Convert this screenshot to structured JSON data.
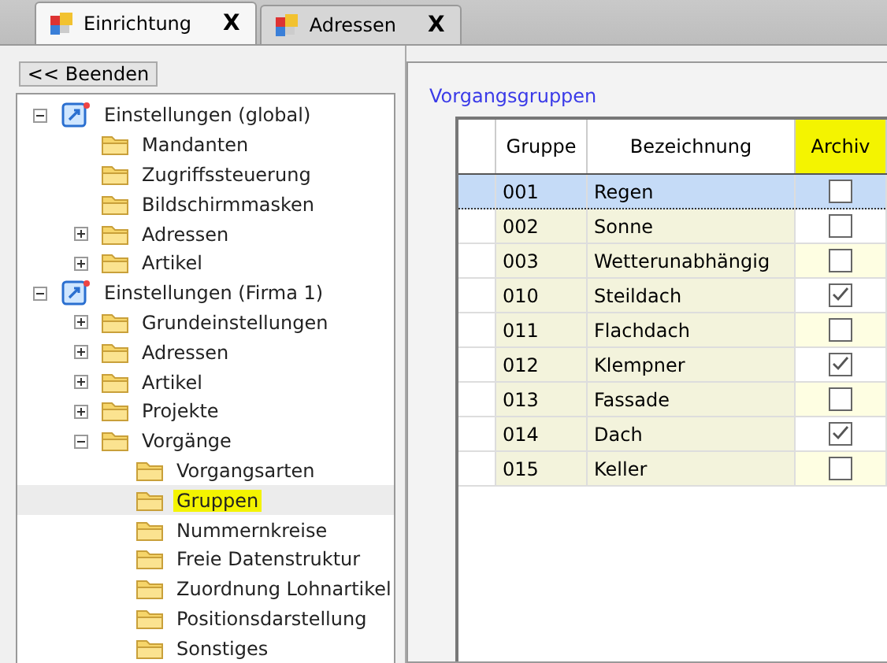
{
  "tabs": [
    {
      "label": "Einrichtung",
      "close": "X",
      "selected": true
    },
    {
      "label": "Adressen",
      "close": "X",
      "selected": false
    }
  ],
  "back_button": "<< Beenden",
  "tree": [
    {
      "label": "Einstellungen (global)",
      "kind": "settings",
      "expanded": true,
      "selected": false,
      "highlighted": false,
      "children": [
        {
          "label": "Mandanten",
          "kind": "folder",
          "selected": false,
          "highlighted": false
        },
        {
          "label": "Zugriffssteuerung",
          "kind": "folder",
          "selected": false,
          "highlighted": false
        },
        {
          "label": "Bildschirmmasken",
          "kind": "folder",
          "selected": false,
          "highlighted": false
        },
        {
          "label": "Adressen",
          "kind": "folder",
          "expanded": false,
          "selected": false,
          "highlighted": false
        },
        {
          "label": "Artikel",
          "kind": "folder",
          "expanded": false,
          "selected": false,
          "highlighted": false
        }
      ]
    },
    {
      "label": "Einstellungen (Firma 1)",
      "kind": "settings",
      "expanded": true,
      "selected": false,
      "highlighted": false,
      "children": [
        {
          "label": "Grundeinstellungen",
          "kind": "folder",
          "expanded": false,
          "selected": false,
          "highlighted": false
        },
        {
          "label": "Adressen",
          "kind": "folder",
          "expanded": false,
          "selected": false,
          "highlighted": false
        },
        {
          "label": "Artikel",
          "kind": "folder",
          "expanded": false,
          "selected": false,
          "highlighted": false
        },
        {
          "label": "Projekte",
          "kind": "folder",
          "expanded": false,
          "selected": false,
          "highlighted": false
        },
        {
          "label": "Vorgänge",
          "kind": "folder",
          "expanded": true,
          "selected": false,
          "highlighted": false,
          "children": [
            {
              "label": "Vorgangsarten",
              "kind": "folder",
              "selected": false,
              "highlighted": false
            },
            {
              "label": "Gruppen",
              "kind": "folder",
              "selected": true,
              "highlighted": true
            },
            {
              "label": "Nummernkreise",
              "kind": "folder",
              "selected": false,
              "highlighted": false
            },
            {
              "label": "Freie Datenstruktur",
              "kind": "folder",
              "selected": false,
              "highlighted": false
            },
            {
              "label": "Zuordnung Lohnartikel",
              "kind": "folder",
              "selected": false,
              "highlighted": false
            },
            {
              "label": "Positionsdarstellung",
              "kind": "folder",
              "selected": false,
              "highlighted": false
            },
            {
              "label": "Sonstiges",
              "kind": "folder",
              "selected": false,
              "highlighted": false
            }
          ]
        }
      ]
    }
  ],
  "group_title": "Vorgangsgruppen",
  "table": {
    "columns": [
      {
        "label": "Gruppe",
        "highlighted": false
      },
      {
        "label": "Bezeichnung",
        "highlighted": false
      },
      {
        "label": "Archiv",
        "highlighted": true
      }
    ],
    "rows": [
      {
        "gruppe": "001",
        "bezeichnung": "Regen",
        "archiv": false,
        "selected": true
      },
      {
        "gruppe": "002",
        "bezeichnung": "Sonne",
        "archiv": false,
        "selected": false
      },
      {
        "gruppe": "003",
        "bezeichnung": "Wetterunabhängig",
        "archiv": false,
        "selected": false
      },
      {
        "gruppe": "010",
        "bezeichnung": "Steildach",
        "archiv": true,
        "selected": false
      },
      {
        "gruppe": "011",
        "bezeichnung": "Flachdach",
        "archiv": false,
        "selected": false
      },
      {
        "gruppe": "012",
        "bezeichnung": "Klempner",
        "archiv": true,
        "selected": false
      },
      {
        "gruppe": "013",
        "bezeichnung": "Fassade",
        "archiv": false,
        "selected": false
      },
      {
        "gruppe": "014",
        "bezeichnung": "Dach",
        "archiv": true,
        "selected": false
      },
      {
        "gruppe": "015",
        "bezeichnung": "Keller",
        "archiv": false,
        "selected": false
      }
    ]
  }
}
